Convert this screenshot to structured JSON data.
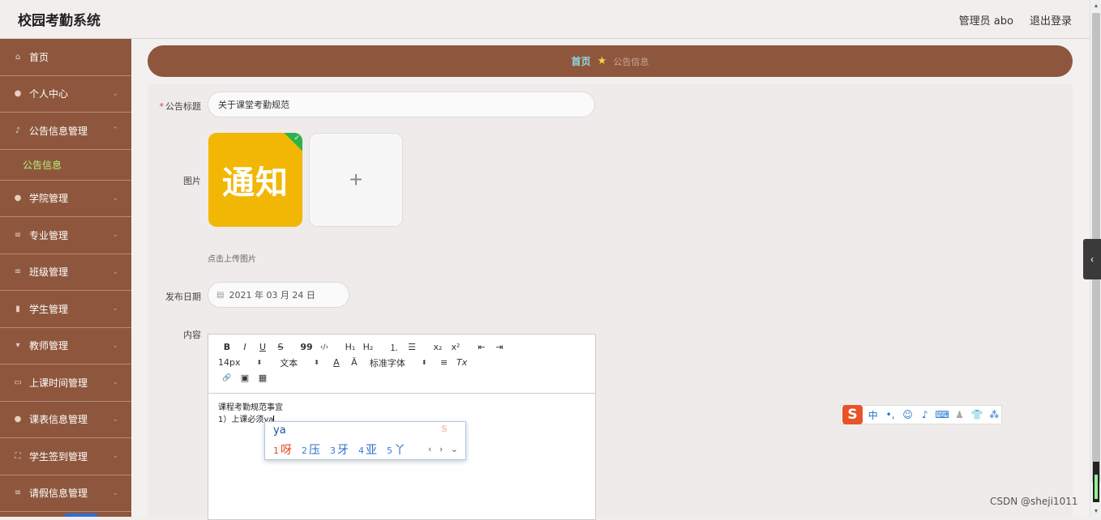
{
  "header": {
    "app_title": "校园考勤系统",
    "user_label": "管理员 abo",
    "logout_label": "退出登录"
  },
  "sidebar": {
    "items": [
      {
        "label": "首页",
        "icon": "home-icon",
        "glyph": "⌂",
        "chevron": false
      },
      {
        "label": "个人中心",
        "icon": "user-icon",
        "glyph": "●",
        "chevron": true
      },
      {
        "label": "公告信息管理",
        "icon": "mic-icon",
        "glyph": "♪",
        "chevron": true,
        "expanded": true
      },
      {
        "label": "学院管理",
        "icon": "pin-icon",
        "glyph": "●",
        "chevron": true
      },
      {
        "label": "专业管理",
        "icon": "sliders-icon",
        "glyph": "≡",
        "chevron": true
      },
      {
        "label": "班级管理",
        "icon": "list-icon",
        "glyph": "≡",
        "chevron": true
      },
      {
        "label": "学生管理",
        "icon": "bars-icon",
        "glyph": "▮",
        "chevron": true
      },
      {
        "label": "教师管理",
        "icon": "pin-icon",
        "glyph": "▾",
        "chevron": true
      },
      {
        "label": "上课时间管理",
        "icon": "chat-icon",
        "glyph": "▭",
        "chevron": true
      },
      {
        "label": "课表信息管理",
        "icon": "user-icon",
        "glyph": "●",
        "chevron": true
      },
      {
        "label": "学生签到管理",
        "icon": "frame-icon",
        "glyph": "⛶",
        "chevron": true
      },
      {
        "label": "请假信息管理",
        "icon": "list-icon",
        "glyph": "≡",
        "chevron": true
      }
    ],
    "sub_item": "公告信息"
  },
  "breadcrumb": {
    "home": "首页",
    "current": "公告信息"
  },
  "form": {
    "title_label": "公告标题",
    "title_value": "关于课堂考勤规范",
    "image_label": "图片",
    "image_text": "通知",
    "add_glyph": "+",
    "upload_tip": "点击上传图片",
    "date_label": "发布日期",
    "date_value": "2021 年 03 月 24 日",
    "content_label": "内容"
  },
  "editor": {
    "toolbar": {
      "bold": "B",
      "italic": "I",
      "underline": "U",
      "strike": "S",
      "quote": "99",
      "code": "‹/›",
      "h1": "H₁",
      "h2": "H₂",
      "ol": "⒈",
      "ul": "☰",
      "sub": "x₂",
      "sup": "x²",
      "outdent": "⇤",
      "indent": "⇥",
      "size": "14px",
      "format": "文本",
      "color": "A",
      "bg": "Ā",
      "font": "标准字体",
      "align": "≡",
      "clear": "Tx",
      "link": "🔗",
      "image": "▣",
      "video": "▦"
    },
    "content_lines": [
      "课程考勤规范事宜",
      "1）上课必须ya"
    ]
  },
  "ime": {
    "input": "ya",
    "candidates": [
      {
        "n": "1",
        "w": "呀"
      },
      {
        "n": "2",
        "w": "压"
      },
      {
        "n": "3",
        "w": "牙"
      },
      {
        "n": "4",
        "w": "亚"
      },
      {
        "n": "5",
        "w": "丫"
      }
    ],
    "nav": "‹ › ⌄",
    "bar_logo": "S",
    "bar_items": [
      "中",
      "•,",
      "☺",
      "♪",
      "⌨",
      "♟",
      "👕",
      "⁂"
    ]
  },
  "watermark": "CSDN @sheji1011",
  "colors": {
    "sidebar_bg": "#8e573d",
    "accent_green": "#b5f07a",
    "breadcrumb_home": "#8fd9e8"
  }
}
